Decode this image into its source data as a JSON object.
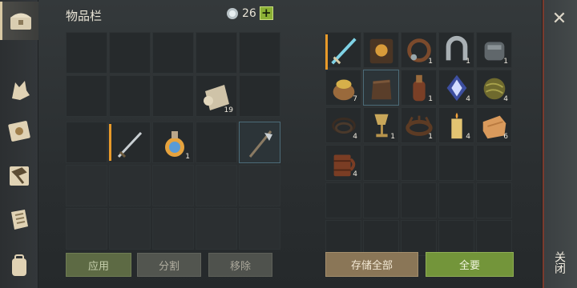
{
  "sidebar": {
    "items": [
      {
        "name": "chest-icon",
        "active": true
      },
      {
        "name": "wolf-icon",
        "active": false
      },
      {
        "name": "book-sun-icon",
        "active": false
      },
      {
        "name": "hammer-icon",
        "active": false
      },
      {
        "name": "scroll-icon",
        "active": false
      },
      {
        "name": "backpack-icon",
        "active": false
      }
    ]
  },
  "inventory": {
    "title": "物品栏",
    "currency": "26",
    "plus_label": "+",
    "bag": [
      {},
      {},
      {},
      {},
      {},
      {},
      {},
      {},
      {
        "icon": "paper-roll-icon",
        "count": "19"
      },
      {}
    ],
    "belt": [
      {},
      {
        "icon": "sword-icon",
        "accent": true
      },
      {
        "icon": "potion-icon",
        "count": "1"
      },
      {},
      {
        "icon": "halberd-icon",
        "selected": true
      }
    ],
    "buttons": {
      "apply": "应用",
      "split": "分割",
      "remove": "移除"
    }
  },
  "storage": {
    "items": [
      {
        "icon": "ice-sword-icon",
        "accent": true
      },
      {
        "icon": "tome-icon"
      },
      {
        "icon": "collar-icon",
        "count": "1"
      },
      {
        "icon": "horseshoe-icon",
        "count": "1"
      },
      {
        "icon": "gauntlet-icon",
        "count": "1"
      },
      {
        "icon": "seed-bag-icon",
        "count": "7"
      },
      {
        "icon": "leather-bag-icon"
      },
      {
        "icon": "bottle-icon",
        "count": "1"
      },
      {
        "icon": "crystal-icon",
        "count": "4"
      },
      {
        "icon": "herb-ball-icon",
        "count": "4"
      },
      {
        "icon": "rope-icon",
        "count": "4"
      },
      {
        "icon": "goblet-icon",
        "count": "1"
      },
      {
        "icon": "crown-icon",
        "count": "1"
      },
      {
        "icon": "candle-icon",
        "count": "4"
      },
      {
        "icon": "cloth-icon",
        "count": "6"
      },
      {
        "icon": "mug-icon",
        "count": "4"
      }
    ],
    "buttons": {
      "store_all": "存储全部",
      "take_all": "全要"
    }
  },
  "close": {
    "icon": "close-icon",
    "label": "关闭"
  },
  "colors": {
    "accent_orange": "#e89a2a",
    "green_button": "#73953a",
    "tan_button": "#8a7657"
  }
}
